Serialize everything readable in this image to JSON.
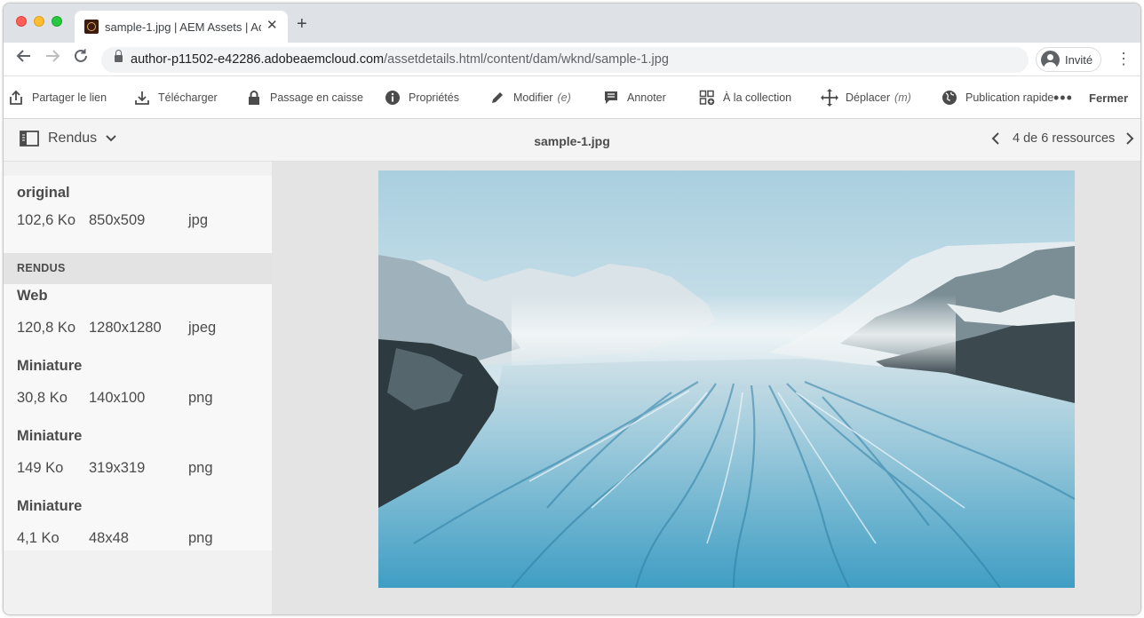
{
  "browser": {
    "tab_title": "sample-1.jpg | AEM Assets | Ad",
    "url_host": "author-p11502-e42286.adobeaemcloud.com",
    "url_path": "/assetdetails.html/content/dam/wknd/sample-1.jpg",
    "profile_label": "Invité"
  },
  "toolbar": {
    "actions": [
      {
        "label": "Partager le lien",
        "icon": "share-icon"
      },
      {
        "label": "Télécharger",
        "icon": "download-icon"
      },
      {
        "label": "Passage en caisse",
        "icon": "lock-icon"
      },
      {
        "label": "Propriétés",
        "icon": "info-icon"
      },
      {
        "label": "Modifier",
        "shortcut": "(e)",
        "icon": "pencil-icon"
      },
      {
        "label": "Annoter",
        "icon": "comment-icon"
      },
      {
        "label": "À la collection",
        "icon": "collection-add-icon"
      },
      {
        "label": "Déplacer",
        "shortcut": "(m)",
        "icon": "move-icon"
      },
      {
        "label": "Publication rapide",
        "icon": "globe-icon"
      }
    ],
    "close_label": "Fermer"
  },
  "subheader": {
    "panel_label": "Rendus",
    "asset_title": "sample-1.jpg",
    "pager_label": "4 de 6 ressources"
  },
  "renditions": {
    "original": {
      "name": "original",
      "size": "102,6 Ko",
      "dimensions": "850x509",
      "format": "jpg"
    },
    "section_label": "RENDUS",
    "items": [
      {
        "name": "Web",
        "size": "120,8 Ko",
        "dimensions": "1280x1280",
        "format": "jpeg"
      },
      {
        "name": "Miniature",
        "size": "30,8 Ko",
        "dimensions": "140x100",
        "format": "png"
      },
      {
        "name": "Miniature",
        "size": "149 Ko",
        "dimensions": "319x319",
        "format": "png"
      },
      {
        "name": "Miniature",
        "size": "4,1 Ko",
        "dimensions": "48x48",
        "format": "png"
      }
    ]
  },
  "colors": {
    "tab_bar": "#dee1e6",
    "toolbar_text": "#4b4b4b",
    "preview_bg": "#e4e4e4",
    "panel_bg": "#f8f8f8"
  }
}
